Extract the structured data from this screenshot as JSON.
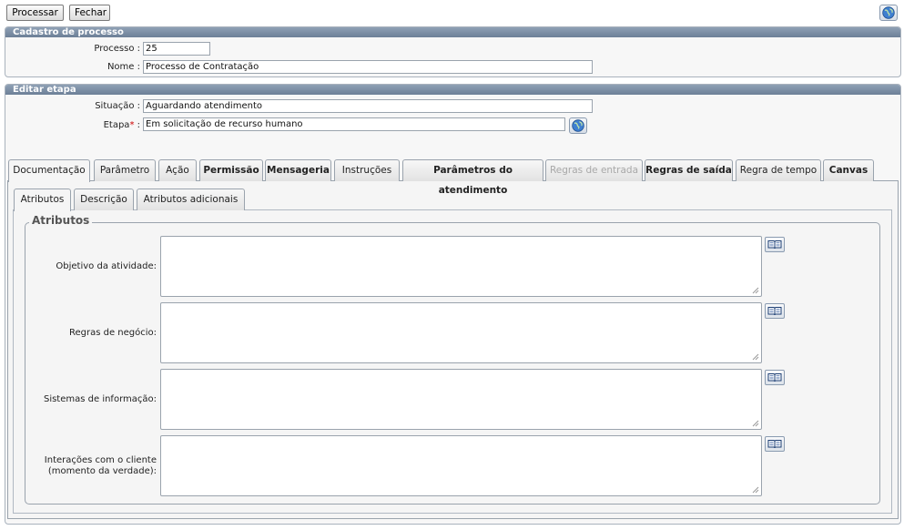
{
  "toolbar": {
    "process_label": "Processar",
    "close_label": "Fechar"
  },
  "cadastro": {
    "title": "Cadastro de processo",
    "processo_label": "Processo :",
    "processo_value": "25",
    "nome_label": "Nome :",
    "nome_value": "Processo de Contratação"
  },
  "editar": {
    "title": "Editar etapa",
    "situacao_label": "Situação :",
    "situacao_value": "Aguardando atendimento",
    "etapa_label": "Etapa",
    "etapa_required": "*",
    "etapa_colon": " :",
    "etapa_value": "Em solicitação de  recurso humano"
  },
  "tabs": [
    {
      "label": "Documentação"
    },
    {
      "label": "Parâmetro"
    },
    {
      "label": "Ação"
    },
    {
      "label": "Permissão"
    },
    {
      "label": "Mensageria"
    },
    {
      "label": "Instruções"
    },
    {
      "label": "Parâmetros do atendimento"
    },
    {
      "label": "Regras de entrada"
    },
    {
      "label": "Regras de saída"
    },
    {
      "label": "Regra de tempo"
    },
    {
      "label": "Canvas"
    }
  ],
  "subtabs": [
    {
      "label": "Atributos"
    },
    {
      "label": "Descrição"
    },
    {
      "label": "Atributos adicionais"
    }
  ],
  "attributes": {
    "legend": "Atributos",
    "objetivo_label": "Objetivo da atividade:",
    "regras_label": "Regras de negócio:",
    "sistemas_label": "Sistemas de informação:",
    "interacoes_label_1": "Interações com o cliente",
    "interacoes_label_2": "(momento da verdade):"
  },
  "colors": {
    "header": "#7b8da4",
    "required": "#cc0000",
    "disabled": "#a8a8a8"
  },
  "icons": [
    "help-globe-icon",
    "lookup-globe-icon",
    "book-icon",
    "resize-grip-icon"
  ]
}
